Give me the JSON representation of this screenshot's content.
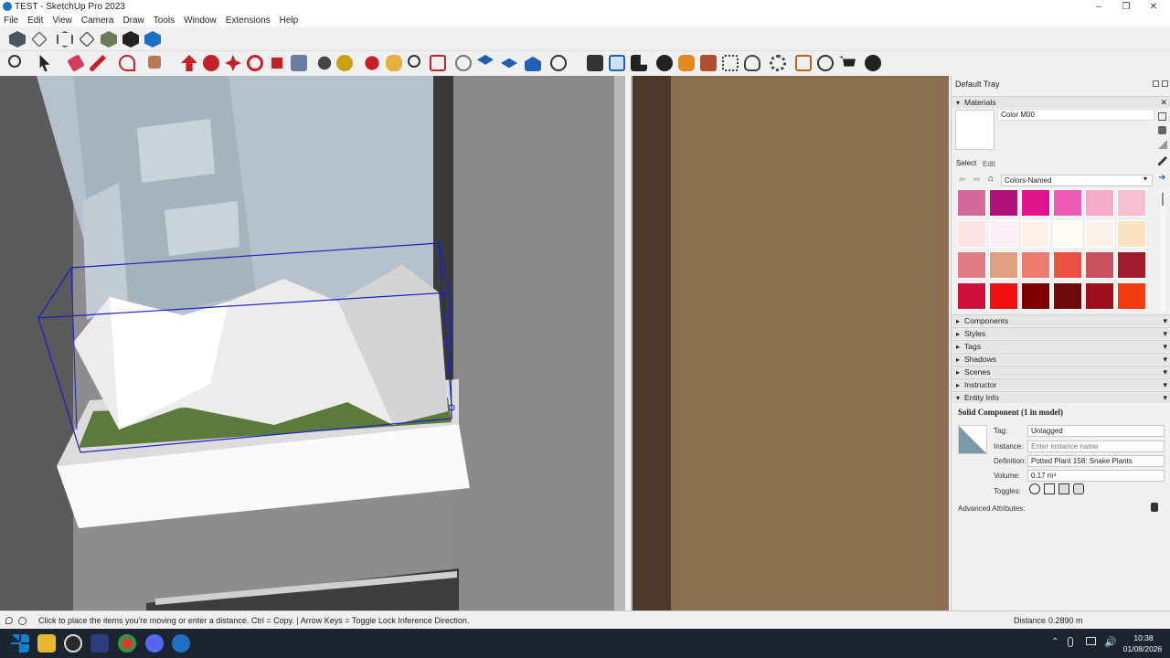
{
  "window": {
    "title": "TEST - SketchUp Pro 2023"
  },
  "menu": [
    "File",
    "Edit",
    "View",
    "Camera",
    "Draw",
    "Tools",
    "Window",
    "Extensions",
    "Help"
  ],
  "tray": {
    "title": "Default Tray",
    "materials": {
      "header": "Materials",
      "current_name": "Color M00",
      "tabs": [
        "Select",
        "Edit"
      ],
      "library": "Colors-Named",
      "swatches": [
        "#d4689a",
        "#b0107a",
        "#e0128e",
        "#ec5bb6",
        "#f4aac8",
        "#f6c0d4",
        "#fbe3e6",
        "#fbeef4",
        "#fdf1e8",
        "#fefaf5",
        "#fdf2ea",
        "#fbe3c2",
        "#e27b86",
        "#e0a080",
        "#ec7b70",
        "#ec5040",
        "#c85060",
        "#a01c2c",
        "#d0103c",
        "#f01010",
        "#800000",
        "#6e0a0a",
        "#a0101c",
        "#f03c10"
      ]
    },
    "sections": [
      "Components",
      "Styles",
      "Tags",
      "Shadows",
      "Scenes",
      "Instructor"
    ],
    "entity": {
      "header": "Entity Info",
      "title": "Solid Component (1 in model)",
      "tag_label": "Tag:",
      "tag_value": "Untagged",
      "instance_label": "Instance:",
      "instance_placeholder": "Enter instance name",
      "definition_label": "Definition:",
      "definition_value": "Potted Plant 158: Snake Plants",
      "volume_label": "Volume:",
      "volume_value": "0.17 m³",
      "toggles_label": "Toggles:",
      "advanced": "Advanced Attributes:"
    }
  },
  "status": {
    "message": "Click to place the items you're moving or enter a distance. Ctrl = Copy. | Arrow Keys = Toggle Lock Inference Direction.",
    "measure_label": "Distance",
    "measure_value": "0.2890 m"
  },
  "clock": {
    "time": "10:38",
    "date": "01/08/2026"
  }
}
